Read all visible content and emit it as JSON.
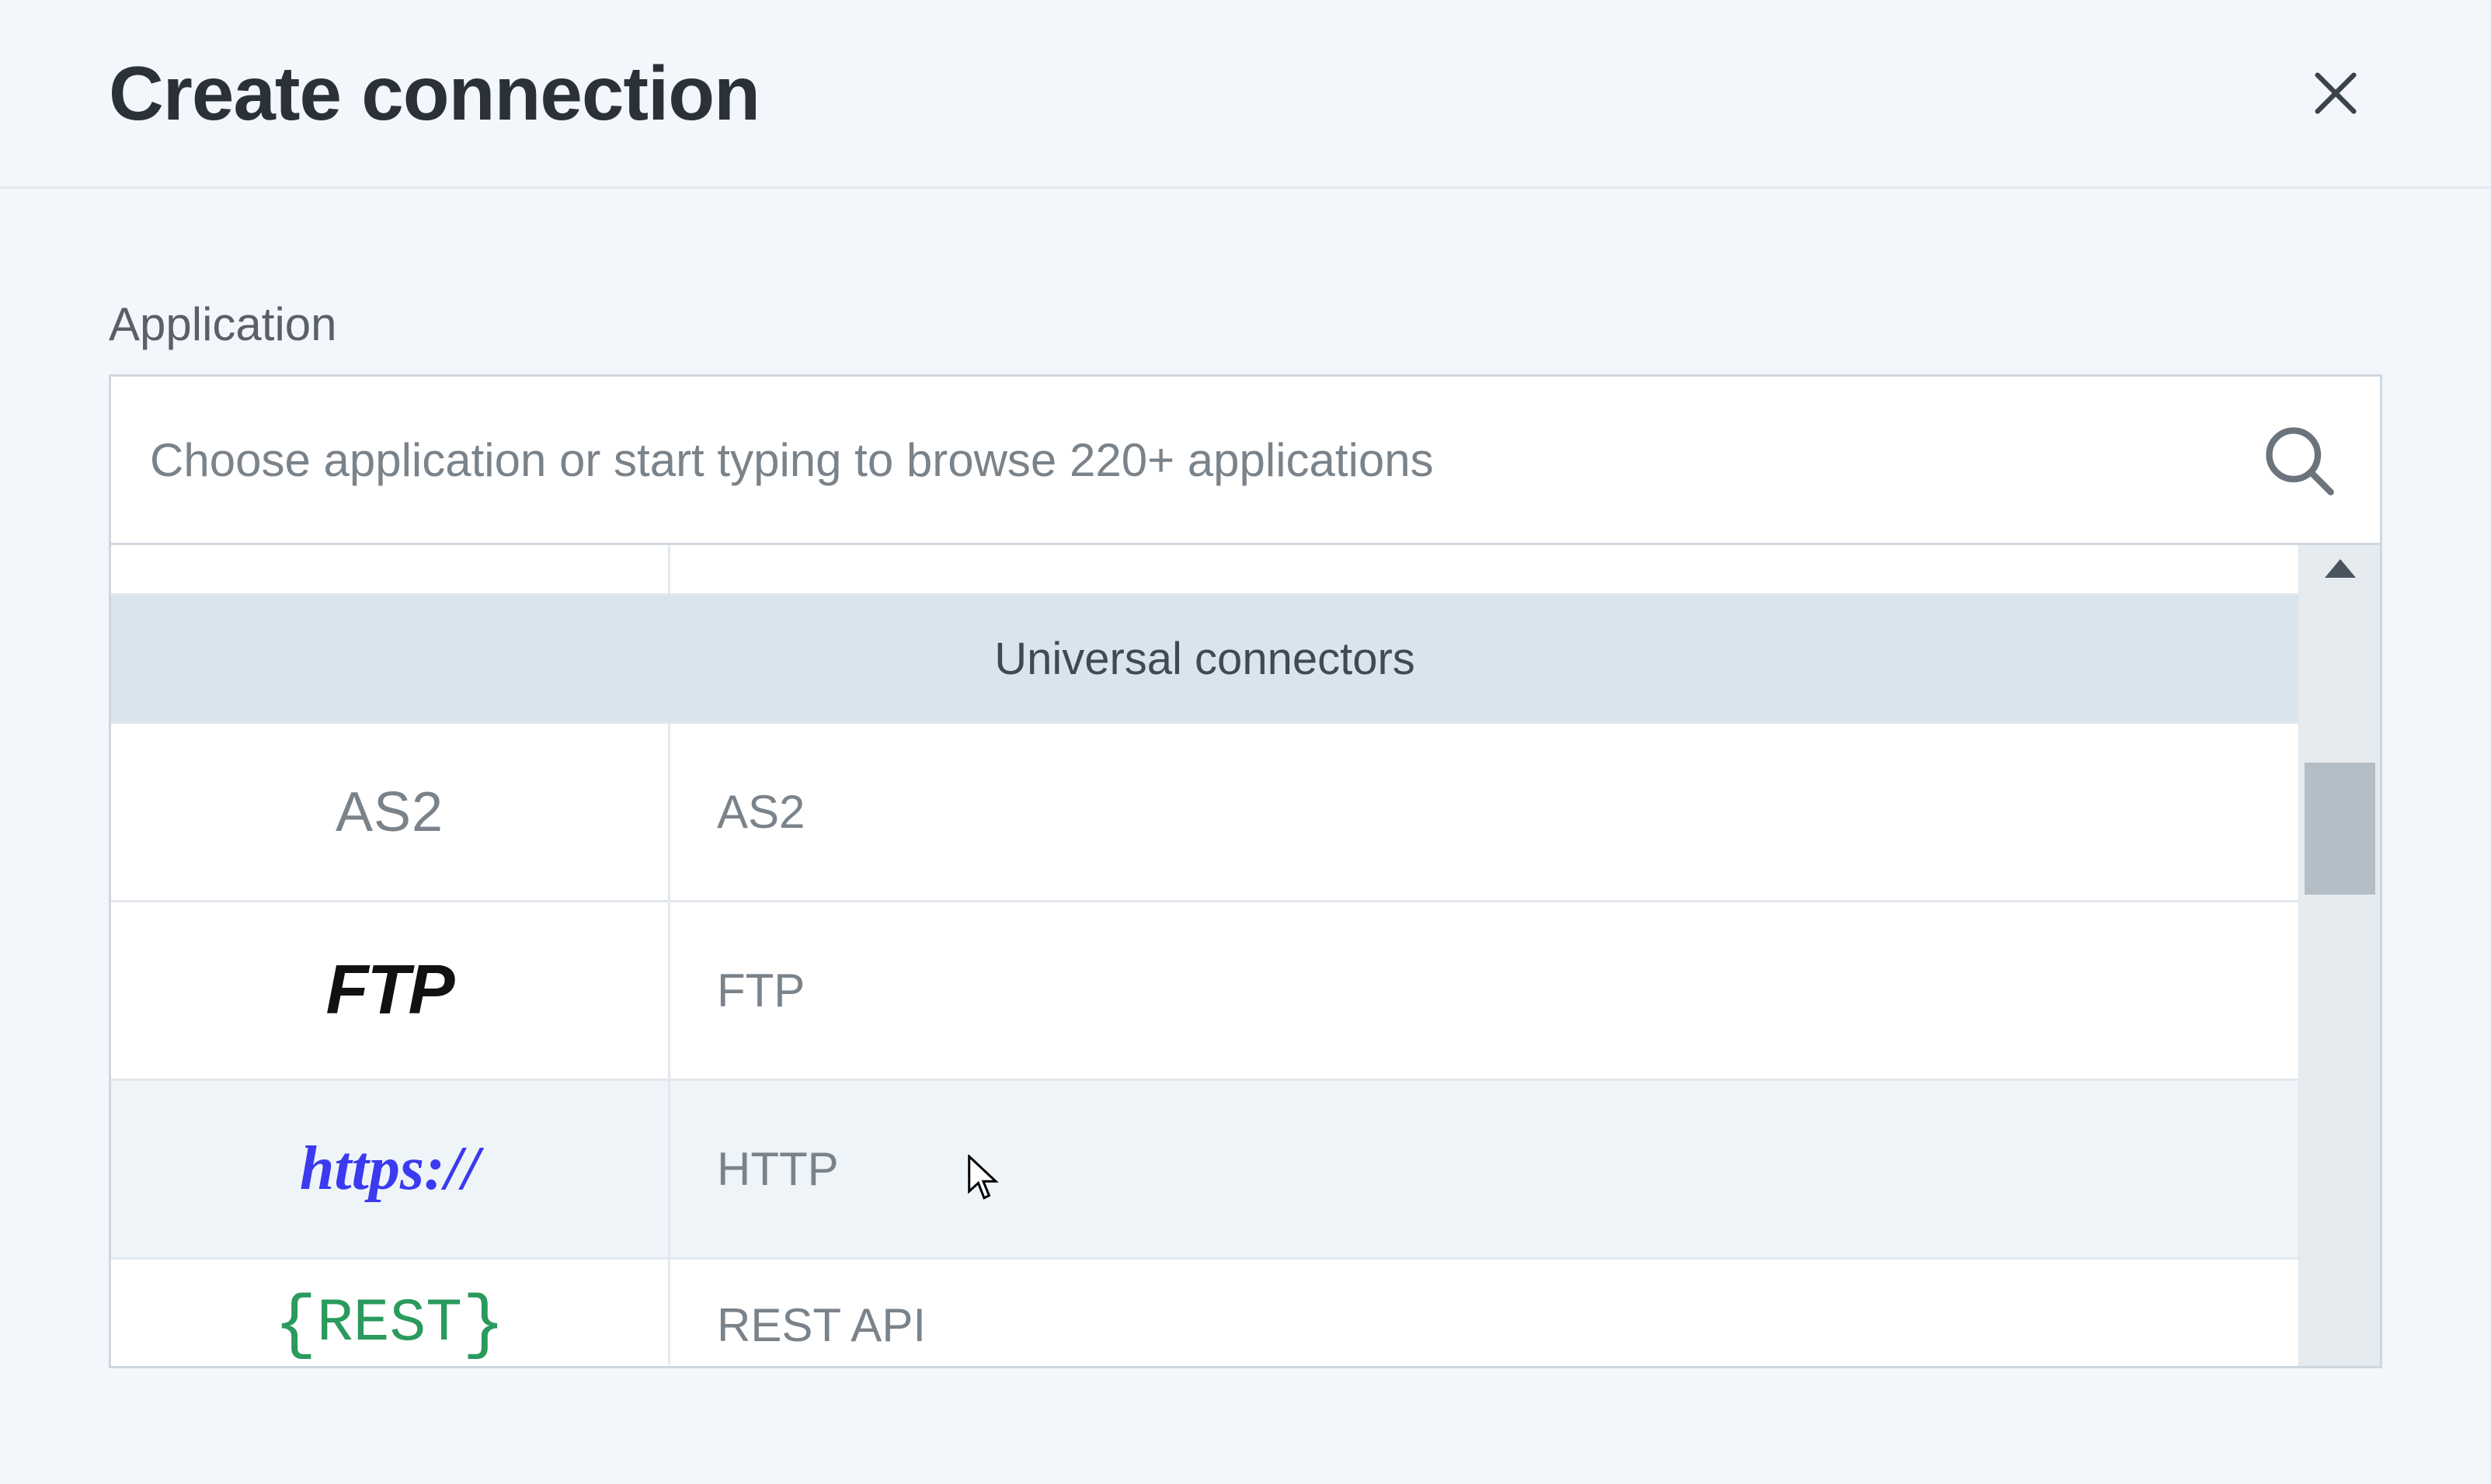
{
  "dialog": {
    "title": "Create connection"
  },
  "field": {
    "label": "Application",
    "placeholder": "Choose application or start typing to browse 220+ applications"
  },
  "section": {
    "header": "Universal connectors"
  },
  "connectors": [
    {
      "icon_text": "AS2",
      "icon_class": "ico-as2",
      "name": "AS2"
    },
    {
      "icon_text": "FTP",
      "icon_class": "ico-ftp",
      "name": "FTP"
    },
    {
      "icon_text": "https://",
      "icon_class": "ico-http",
      "name": "HTTP"
    },
    {
      "icon_text": "{REST}",
      "icon_class": "ico-rest",
      "name": "REST API"
    }
  ]
}
